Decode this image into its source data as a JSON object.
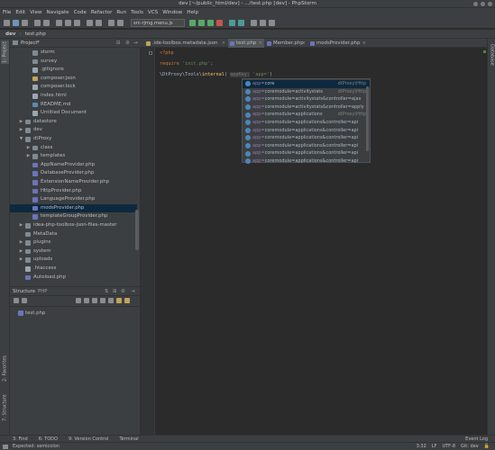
{
  "window": {
    "title": "dev [~/public_html/dev] - .../test.php [dev] - PhpStorm"
  },
  "menu": [
    "File",
    "Edit",
    "View",
    "Navigate",
    "Code",
    "Refactor",
    "Run",
    "Tools",
    "VCS",
    "Window",
    "Help"
  ],
  "toolbar": {
    "run_config": "src-rjmg.menu.js"
  },
  "breadcrumbs": [
    "dev",
    "test.php"
  ],
  "left_tabs": {
    "project": "1: Project",
    "favorites": "2: Favorites",
    "structure": "7: Structure"
  },
  "right_tabs": {
    "database": "Database"
  },
  "project_panel": {
    "title": "Project",
    "tree": [
      {
        "label": "storm",
        "kind": "folder",
        "indent": 2,
        "arrow": ""
      },
      {
        "label": "survey",
        "kind": "folder",
        "indent": 2,
        "arrow": ""
      },
      {
        "label": ".gitignore",
        "kind": "generic",
        "indent": 2,
        "arrow": ""
      },
      {
        "label": "composer.json",
        "kind": "json",
        "indent": 2,
        "arrow": ""
      },
      {
        "label": "composer.lock",
        "kind": "generic",
        "indent": 2,
        "arrow": ""
      },
      {
        "label": "index.html",
        "kind": "generic",
        "indent": 2,
        "arrow": ""
      },
      {
        "label": "README.md",
        "kind": "md",
        "indent": 2,
        "arrow": ""
      },
      {
        "label": "Untitled Document",
        "kind": "generic",
        "indent": 2,
        "arrow": ""
      },
      {
        "label": "datastore",
        "kind": "folder",
        "indent": 1,
        "arrow": "▶"
      },
      {
        "label": "dev",
        "kind": "folder",
        "indent": 1,
        "arrow": "▶"
      },
      {
        "label": "dtProxy",
        "kind": "folder",
        "indent": 1,
        "arrow": "▼"
      },
      {
        "label": "class",
        "kind": "folder",
        "indent": 2,
        "arrow": "▶"
      },
      {
        "label": "templates",
        "kind": "folder",
        "indent": 2,
        "arrow": "▶"
      },
      {
        "label": "AppNameProvider.php",
        "kind": "php",
        "indent": 2,
        "arrow": ""
      },
      {
        "label": "DatabaseProvider.php",
        "kind": "php",
        "indent": 2,
        "arrow": ""
      },
      {
        "label": "ExtensionNameProvider.php",
        "kind": "php",
        "indent": 2,
        "arrow": ""
      },
      {
        "label": "HttpProvider.php",
        "kind": "php",
        "indent": 2,
        "arrow": ""
      },
      {
        "label": "LanguageProvider.php",
        "kind": "php",
        "indent": 2,
        "arrow": ""
      },
      {
        "label": "modsProvider.php",
        "kind": "php",
        "indent": 2,
        "arrow": "",
        "selected": true
      },
      {
        "label": "templateGroupProvider.php",
        "kind": "php",
        "indent": 2,
        "arrow": ""
      },
      {
        "label": "idea-php-toolbox-json-files-master",
        "kind": "folder",
        "indent": 1,
        "arrow": "▶"
      },
      {
        "label": "MetaData",
        "kind": "folder",
        "indent": 1,
        "arrow": ""
      },
      {
        "label": "plugins",
        "kind": "folder",
        "indent": 1,
        "arrow": "▶"
      },
      {
        "label": "system",
        "kind": "folder",
        "indent": 1,
        "arrow": "▶"
      },
      {
        "label": "uploads",
        "kind": "folder",
        "indent": 1,
        "arrow": "▶"
      },
      {
        "label": ".htaccess",
        "kind": "generic",
        "indent": 1,
        "arrow": ""
      },
      {
        "label": "Autoload.php",
        "kind": "php",
        "indent": 1,
        "arrow": ""
      }
    ]
  },
  "structure_panel": {
    "tabs": [
      "Structure",
      "PHP"
    ],
    "file": "test.php"
  },
  "editor_tabs": [
    {
      "label": ".ide-toolbox.metadata.json",
      "active": false
    },
    {
      "label": "test.php",
      "active": true
    },
    {
      "label": "Member.php",
      "active": false
    },
    {
      "label": "modsProvider.php",
      "active": false
    }
  ],
  "code": {
    "line1": "<?php",
    "line2_kw": "require",
    "line2_str": "'init.php'",
    "line2_end": ";",
    "line3_pre": "\\DtProxy\\Tools\\",
    "line3_kw": "internal",
    "line3_mid": "(",
    "line3_param": "appKey:",
    "line3_str": "'app='",
    "line3_end": ")"
  },
  "autocomplete": [
    {
      "name": "app=core",
      "type": "dtProxy\\Http"
    },
    {
      "name": "app=coremodule=activitystats",
      "type": "dtProxy\\Http"
    },
    {
      "name": "app=coremodule=activitystats&controller=ajax",
      "type": ""
    },
    {
      "name": "app=coremodule=activitystats&controller=apply",
      "type": ""
    },
    {
      "name": "app=coremodule=applications",
      "type": "dtProxy\\Http"
    },
    {
      "name": "app=coremodule=applications&controller=api",
      "type": ""
    },
    {
      "name": "app=coremodule=applications&controller=api",
      "type": ""
    },
    {
      "name": "app=coremodule=applications&controller=api",
      "type": ""
    },
    {
      "name": "app=coremodule=applications&controller=api",
      "type": ""
    },
    {
      "name": "app=coremodule=applications&controller=api",
      "type": ""
    },
    {
      "name": "app=coremodule=applications&controller=api",
      "type": ""
    }
  ],
  "tool_windows": [
    "3: Find",
    "6: TODO",
    "9: Version Control",
    "Terminal"
  ],
  "event_log": "Event Log",
  "status": {
    "message": "Expected: semicolon",
    "position": "3:32",
    "line_sep": "LF",
    "encoding": "UTF-8",
    "vcs": "Git: dev"
  }
}
